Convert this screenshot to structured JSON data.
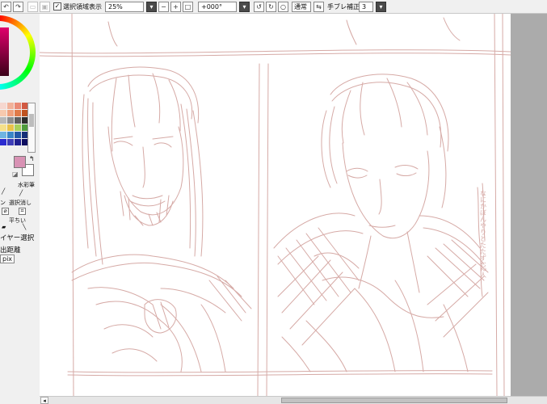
{
  "toolbar": {
    "show_selection_label": "選択領域表示",
    "show_selection_checked": "✓",
    "zoom": "25%",
    "rotation": "+000°",
    "blend_mode": "通常",
    "stabilizer_label": "手ブレ補正",
    "stabilizer_value": "3",
    "icons": {
      "undo": "↶",
      "redo": "↷",
      "deselect": "▭",
      "select_all": "▣",
      "zoom_out": "−",
      "zoom_in": "+",
      "zoom_reset": "□",
      "rotate_left": "↺",
      "rotate_right": "↻",
      "rotate_reset": "○",
      "flip": "⇆"
    }
  },
  "left_panel": {
    "swap_icon": "↰",
    "reset_icon": "◪",
    "tools": [
      {
        "label": "水彩筆",
        "icon": "brush-icon"
      },
      {
        "label": "選択消し",
        "icon": "eraser-icon"
      },
      {
        "label": "平ちい",
        "icon": "flat-brush-icon"
      }
    ],
    "tool_fragments": [
      "ン",
      "ン"
    ],
    "layer_select_label": "イヤー選択",
    "distance_label": "出距離",
    "unit_label": "pix",
    "swatch_colors": [
      "#f6d7cf",
      "#f2b199",
      "#ea8a75",
      "#d25a43",
      "#f7c9ae",
      "#efa07c",
      "#e07a48",
      "#c0531f",
      "#b8b8b8",
      "#8d8d8d",
      "#5e5e5e",
      "#2d2d2d",
      "#f5e08a",
      "#e9c24a",
      "#a9cf5a",
      "#4f9b3c",
      "#6fb4e2",
      "#3a86c8",
      "#2358a8",
      "#162f78",
      "#2b2bd0",
      "#3d3db8",
      "#1f1f90",
      "#0e0e60"
    ],
    "colors": {
      "foreground": "#d892b4",
      "background": "#ffffff"
    }
  },
  "canvas": {
    "sketch_color": "#d6aaa6",
    "border_color": "#9b9bc8",
    "margin_color": "#ababab",
    "side_note": "なにかぼんやりとたたずむ2人"
  },
  "scrollbar": {
    "left_arrow": "◂"
  }
}
